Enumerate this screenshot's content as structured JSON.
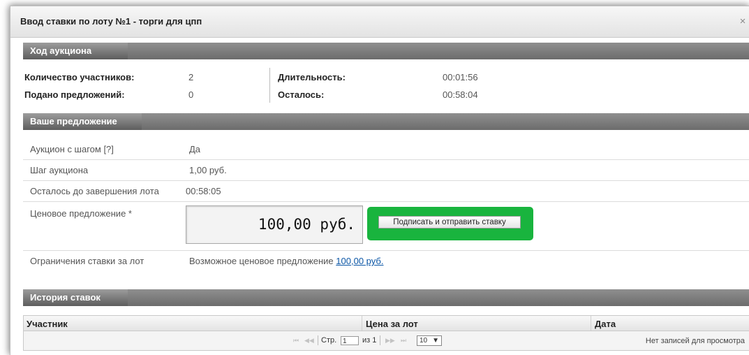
{
  "dialog": {
    "title": "Ввод ставки по лоту №1 - торги для цпп",
    "close_label": "×"
  },
  "progress": {
    "header": "Ход аукциона",
    "participants_label": "Количество участников:",
    "participants_value": "2",
    "bids_label": "Подано предложений:",
    "bids_value": "0",
    "duration_label": "Длительность:",
    "duration_value": "00:01:56",
    "remaining_label": "Осталось:",
    "remaining_value": "00:58:04"
  },
  "offer": {
    "header": "Ваше предложение",
    "step_auction_label": "Аукцион с шагом [?]",
    "step_auction_value": "Да",
    "step_label": "Шаг аукциона",
    "step_value": "1,00 руб.",
    "time_left_label": "Осталось до завершения лота",
    "time_left_value": "00:58:05",
    "price_label": "Ценовое предложение *",
    "price_value": "100,00 руб.",
    "submit_label": "Подписать и отправить ставку",
    "limits_label": "Ограничения ставки за лот",
    "limits_text": "Возможное ценовое предложение",
    "limits_link": "100,00 руб."
  },
  "history": {
    "header": "История ставок",
    "columns": [
      "Участник",
      "Цена за лот",
      "Дата"
    ],
    "pager": {
      "page_label": "Стр.",
      "page_value": "1",
      "of_label": "из 1",
      "page_size": "10",
      "empty_text": "Нет записей для просмотра"
    }
  },
  "colors": {
    "submit_highlight": "#19b43e",
    "section_header": "#7a7a7a",
    "link": "#0b56a6"
  }
}
